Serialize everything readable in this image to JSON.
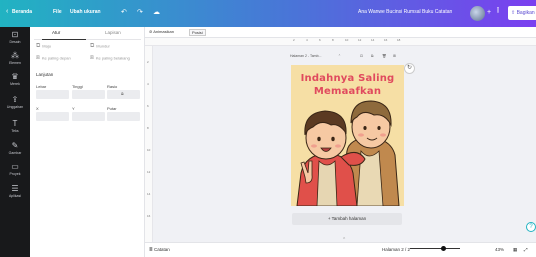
{
  "topbar": {
    "home_label": "Beranda",
    "file_label": "File",
    "resize_label": "Ubah ukuran",
    "undo_icon": "undo-icon",
    "redo_icon": "redo-icon",
    "cloud_icon": "cloud-icon",
    "doc_title": "Ana Wanwe Bucinsi Rumsal Buku Catatan",
    "share_label": "Bagikan"
  },
  "rail": [
    {
      "icon": "template-icon",
      "label": "Desain"
    },
    {
      "icon": "elements-icon",
      "label": "Elemen"
    },
    {
      "icon": "brand-icon",
      "label": "Merek"
    },
    {
      "icon": "upload-icon",
      "label": "Unggahan"
    },
    {
      "icon": "text-icon",
      "label": "Teks"
    },
    {
      "icon": "draw-icon",
      "label": "Gambar"
    },
    {
      "icon": "projects-icon",
      "label": "Proyek"
    },
    {
      "icon": "apps-icon",
      "label": "Aplikasi"
    }
  ],
  "panel": {
    "tab_active": "Atur",
    "tab_other": "Lapisan",
    "opt1": "Maju",
    "opt2": "Mundur",
    "opt3": "Ke paling depan",
    "opt4": "Ke paling belakang",
    "section": "Lanjutan",
    "width_label": "Lebar",
    "height_label": "Tinggi",
    "ratio_label": "Rasio",
    "x_label": "X",
    "y_label": "Y",
    "rotate_label": "Putar"
  },
  "canvas_toolbar": {
    "animate": "Animasikan",
    "position": "Posisi"
  },
  "ruler_ticks": [
    "2",
    "4",
    "6",
    "8",
    "10",
    "12",
    "14",
    "16",
    "18"
  ],
  "page_tools": {
    "page_name": "Halaman 2 - Tamb...",
    "lock_icon": "lock-icon",
    "copy_icon": "copy-icon",
    "delete_icon": "trash-icon",
    "add_icon": "add-page-icon"
  },
  "poster": {
    "line1": "Indahnya Saling",
    "line2": "Memaafkan"
  },
  "add_page_label": "+ Tambah halaman",
  "bottombar": {
    "notes": "Catatan",
    "pages": "Halaman 2 / 2",
    "zoom": "43%",
    "zoom_fraction": 0.43
  },
  "colors": {
    "brand_left": "#21b3c2",
    "brand_right": "#7b3ff0",
    "poster_bg": "#f6dfa5",
    "poster_title": "#e04a5e"
  }
}
